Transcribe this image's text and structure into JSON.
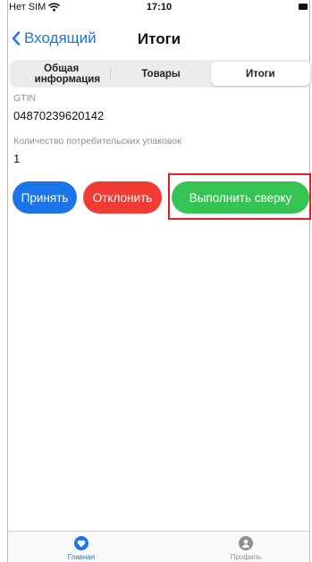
{
  "status_bar": {
    "carrier": "Нет SIM",
    "time": "17:10"
  },
  "nav": {
    "back_label": "Входящий",
    "title": "Итоги"
  },
  "segments": [
    {
      "label": "Общая информация",
      "active": false
    },
    {
      "label": "Товары",
      "active": false
    },
    {
      "label": "Итоги",
      "active": true
    }
  ],
  "fields": {
    "gtin_label": "GTIN",
    "gtin_value": "04870239620142",
    "packages_label": "Количество потребительских упаковок",
    "packages_value": "1"
  },
  "actions": {
    "accept_label": "Принять",
    "reject_label": "Отклонить",
    "reconcile_label": "Выполнить сверку"
  },
  "tabbar": {
    "home_label": "Главная",
    "profile_label": "Профиль"
  },
  "colors": {
    "accent": "#1b74e8",
    "reject": "#f03c35",
    "reconcile": "#35c454",
    "highlight": "#e31f24"
  }
}
